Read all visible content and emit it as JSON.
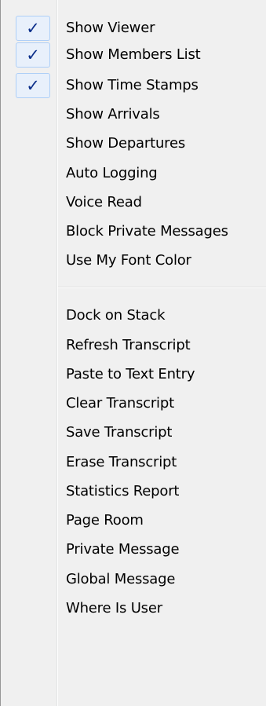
{
  "menu": {
    "group1": [
      {
        "label": "Show Viewer",
        "checked": true
      },
      {
        "label": "Show Members List",
        "checked": true
      },
      {
        "label": "Show Time Stamps",
        "checked": true
      },
      {
        "label": "Show Arrivals",
        "checked": false
      },
      {
        "label": "Show Departures",
        "checked": false
      },
      {
        "label": "Auto Logging",
        "checked": false
      },
      {
        "label": "Voice Read",
        "checked": false
      },
      {
        "label": "Block Private Messages",
        "checked": false
      },
      {
        "label": "Use My Font Color",
        "checked": false
      }
    ],
    "group2": [
      {
        "label": "Dock on Stack"
      },
      {
        "label": "Refresh Transcript"
      },
      {
        "label": "Paste to Text Entry"
      },
      {
        "label": "Clear Transcript"
      },
      {
        "label": "Save Transcript"
      },
      {
        "label": "Erase Transcript"
      },
      {
        "label": "Statistics Report"
      },
      {
        "label": "Page Room"
      },
      {
        "label": "Private Message"
      },
      {
        "label": "Global Message"
      },
      {
        "label": "Where Is User"
      }
    ],
    "check_glyph": "✓"
  }
}
